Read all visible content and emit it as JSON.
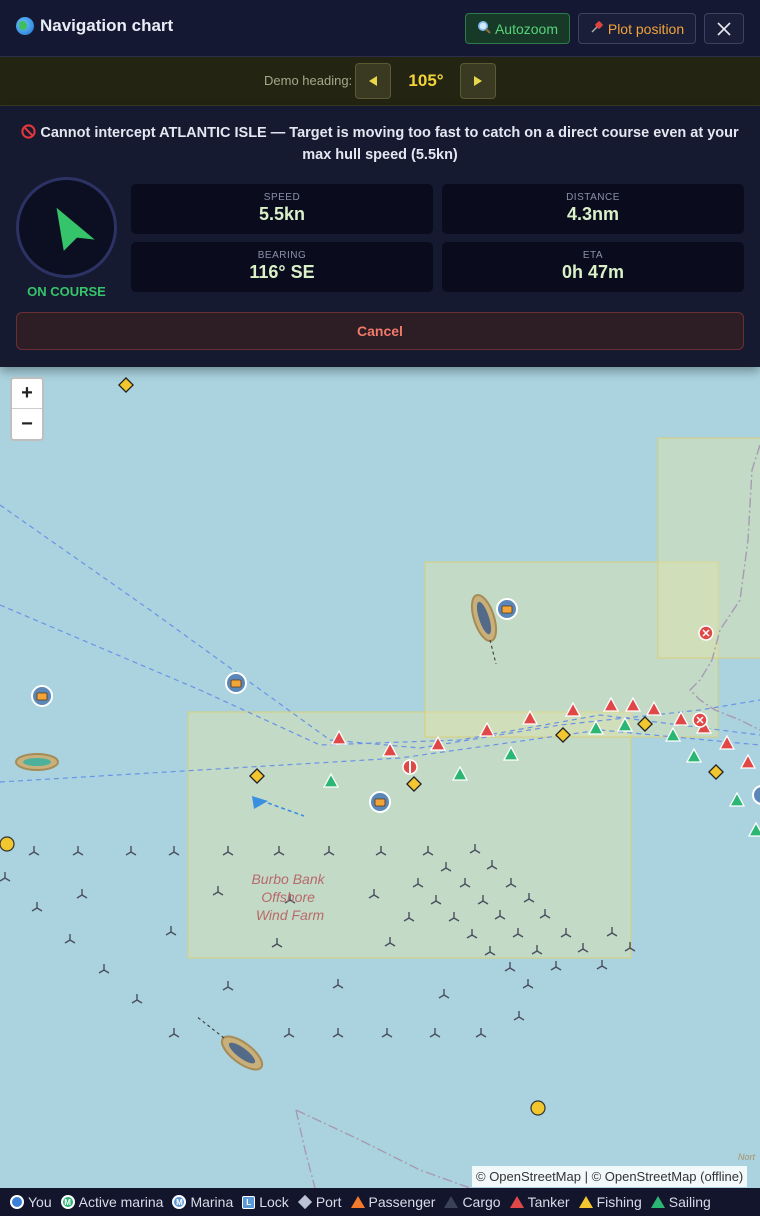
{
  "header": {
    "title": "Navigation chart",
    "autozoom_label": "Autozoom",
    "plot_position_label": "Plot position",
    "close_icon": "close-icon"
  },
  "heading": {
    "label": "Demo heading:",
    "value": "105°"
  },
  "intercept": {
    "warning": "Cannot intercept ATLANTIC ISLE — Target is moving too fast to catch on a direct course even at your max hull speed (5.5kn)",
    "status": "ON COURSE",
    "stats": [
      {
        "label": "SPEED",
        "value": "5.5kn"
      },
      {
        "label": "DISTANCE",
        "value": "4.3nm"
      },
      {
        "label": "BEARING",
        "value": "116° SE"
      },
      {
        "label": "ETA",
        "value": "0h 47m"
      }
    ],
    "cancel_label": "Cancel"
  },
  "map": {
    "zoom_in": "+",
    "zoom_out": "−",
    "wind_farm_label": [
      "Burbo Bank",
      "Offshore",
      "Wind Farm"
    ],
    "edge_label": "Nort",
    "attribution": "© OpenStreetMap | © OpenStreetMap (offline)"
  },
  "legend": [
    {
      "label": "You",
      "icon": "you-dot-icon",
      "color": "#3b7fd6"
    },
    {
      "label": "Active marina",
      "icon": "active-marina-icon",
      "color": "#2bb673"
    },
    {
      "label": "Marina",
      "icon": "marina-icon",
      "color": "#5a9ad8"
    },
    {
      "label": "Lock",
      "icon": "lock-icon",
      "color": "#5a9ad8"
    },
    {
      "label": "Port",
      "icon": "port-diamond-icon",
      "color": "#bcc2d6"
    },
    {
      "label": "Passenger",
      "icon": "passenger-triangle-icon",
      "color": "#f47a2c"
    },
    {
      "label": "Cargo",
      "icon": "cargo-triangle-icon",
      "color": "#3a4258"
    },
    {
      "label": "Tanker",
      "icon": "tanker-triangle-icon",
      "color": "#e04848"
    },
    {
      "label": "Fishing",
      "icon": "fishing-triangle-icon",
      "color": "#f2c62f"
    },
    {
      "label": "Sailing",
      "icon": "sailing-triangle-icon",
      "color": "#2bb673"
    }
  ]
}
